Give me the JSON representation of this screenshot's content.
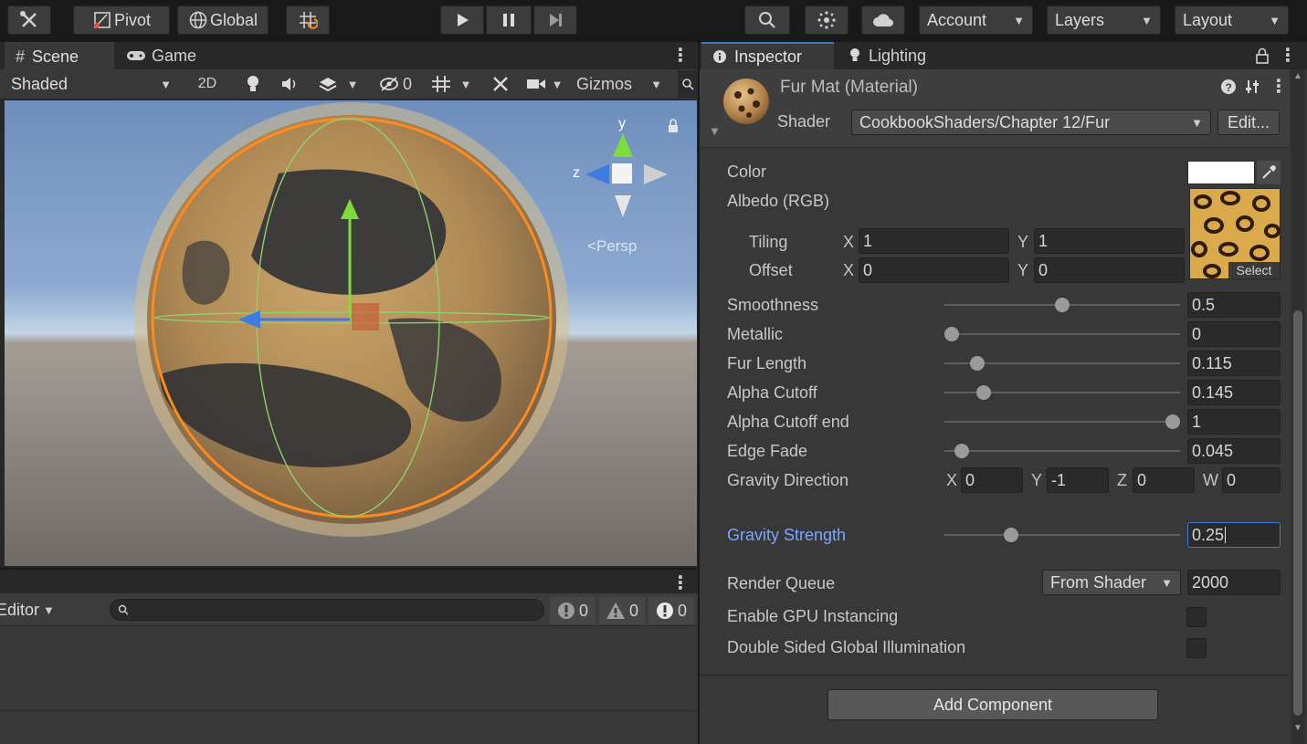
{
  "toolbar": {
    "pivot_label": "Pivot",
    "global_label": "Global",
    "account_label": "Account",
    "layers_label": "Layers",
    "layout_label": "Layout"
  },
  "scene": {
    "tab_scene": "Scene",
    "tab_game": "Game",
    "shading_mode": "Shaded",
    "mode_2d": "2D",
    "hidden_count": "0",
    "gizmos_label": "Gizmos",
    "gizmo_y": "y",
    "gizmo_z": "z",
    "persp_label": "Persp"
  },
  "console": {
    "editor_label": "Editor",
    "error_count": "0",
    "warning_count": "0",
    "info_count": "0"
  },
  "inspector": {
    "tab_inspector": "Inspector",
    "tab_lighting": "Lighting",
    "material_title": "Fur Mat (Material)",
    "shader_label": "Shader",
    "shader_value": "CookbookShaders/Chapter 12/Fur",
    "edit_button": "Edit...",
    "color_label": "Color",
    "albedo_label": "Albedo (RGB)",
    "tiling_label": "Tiling",
    "offset_label": "Offset",
    "tiling_x": "1",
    "tiling_y": "1",
    "offset_x": "0",
    "offset_y": "0",
    "texture_select": "Select",
    "props": [
      {
        "label": "Smoothness",
        "value": "0.5",
        "fraction": 0.5
      },
      {
        "label": "Metallic",
        "value": "0",
        "fraction": 0.0
      },
      {
        "label": "Fur Length",
        "value": "0.115",
        "fraction": 0.115
      },
      {
        "label": "Alpha Cutoff",
        "value": "0.145",
        "fraction": 0.145
      },
      {
        "label": "Alpha Cutoff end",
        "value": "1",
        "fraction": 1.0
      },
      {
        "label": "Edge Fade",
        "value": "0.045",
        "fraction": 0.045
      }
    ],
    "gravity_direction_label": "Gravity Direction",
    "gravity_x": "0",
    "gravity_y": "-1",
    "gravity_z": "0",
    "gravity_w": "0",
    "gravity_strength_label": "Gravity Strength",
    "gravity_strength_value": "0.25",
    "gravity_strength_fraction": 0.27,
    "render_queue_label": "Render Queue",
    "render_queue_mode": "From Shader",
    "render_queue_value": "2000",
    "gpu_instancing_label": "Enable GPU Instancing",
    "double_sided_label": "Double Sided Global Illumination",
    "add_component": "Add Component"
  },
  "colors": {
    "accent_blue": "#7ba6ff",
    "selection_orange": "#ff8a1e",
    "panel_bg": "#383838",
    "field_bg": "#2a2a2a"
  }
}
